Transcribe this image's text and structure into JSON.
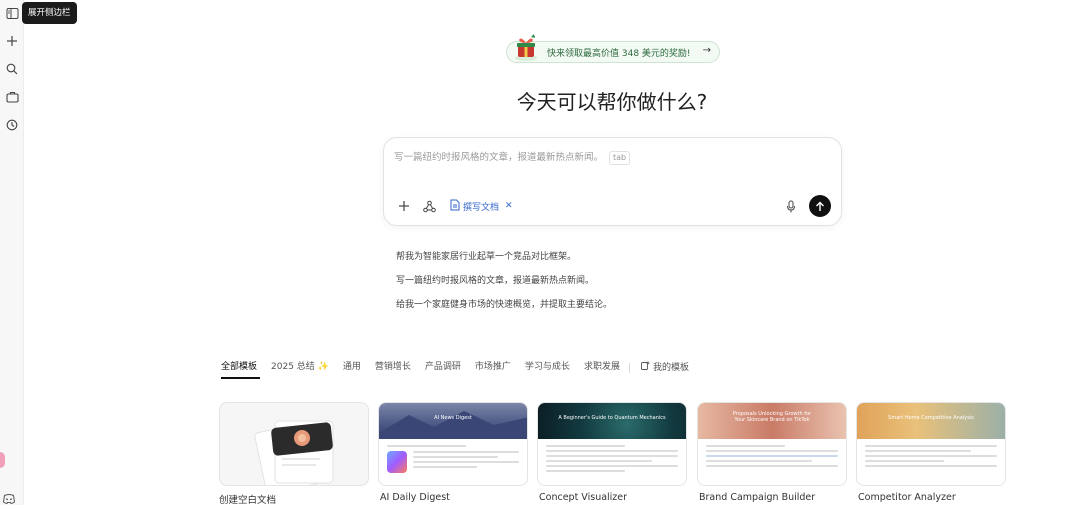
{
  "sidebar": {
    "tooltip": "展开侧边栏",
    "icons": [
      "sidebar-toggle-icon",
      "plus-icon",
      "search-icon",
      "briefcase-icon",
      "history-icon",
      "discord-icon"
    ]
  },
  "promo": {
    "text": "快来领取最高价值 348 美元的奖励!",
    "arrow": "→"
  },
  "headline": "今天可以帮你做什么?",
  "composer": {
    "placeholder": "写一篇纽约时报风格的文章，报道最新热点新闻。",
    "tab_hint": "tab",
    "chip_label": "撰写文档",
    "chip_close": "✕"
  },
  "suggestions": [
    "帮我为智能家居行业起草一个竞品对比框架。",
    "写一篇纽约时报风格的文章，报道最新热点新闻。",
    "给我一个家庭健身市场的快速概览，并提取主要结论。"
  ],
  "tabs": {
    "items": [
      "全部模板",
      "2025 总结 ✨",
      "通用",
      "营销增长",
      "产品调研",
      "市场推广",
      "学习与成长",
      "求职发展"
    ],
    "my_templates": "我的模板"
  },
  "templates": [
    {
      "label": "创建空白文档"
    },
    {
      "label": "AI Daily Digest",
      "thumb_title": "AI News Digest"
    },
    {
      "label": "Concept Visualizer",
      "thumb_title": "A Beginner's Guide to Quantum Mechanics"
    },
    {
      "label": "Brand Campaign Builder",
      "thumb_title": "Proposals Unlocking Growth for Your Skincare Brand on TikTok"
    },
    {
      "label": "Competitor Analyzer",
      "thumb_title": "Smart Home Competitive Analysis"
    }
  ]
}
